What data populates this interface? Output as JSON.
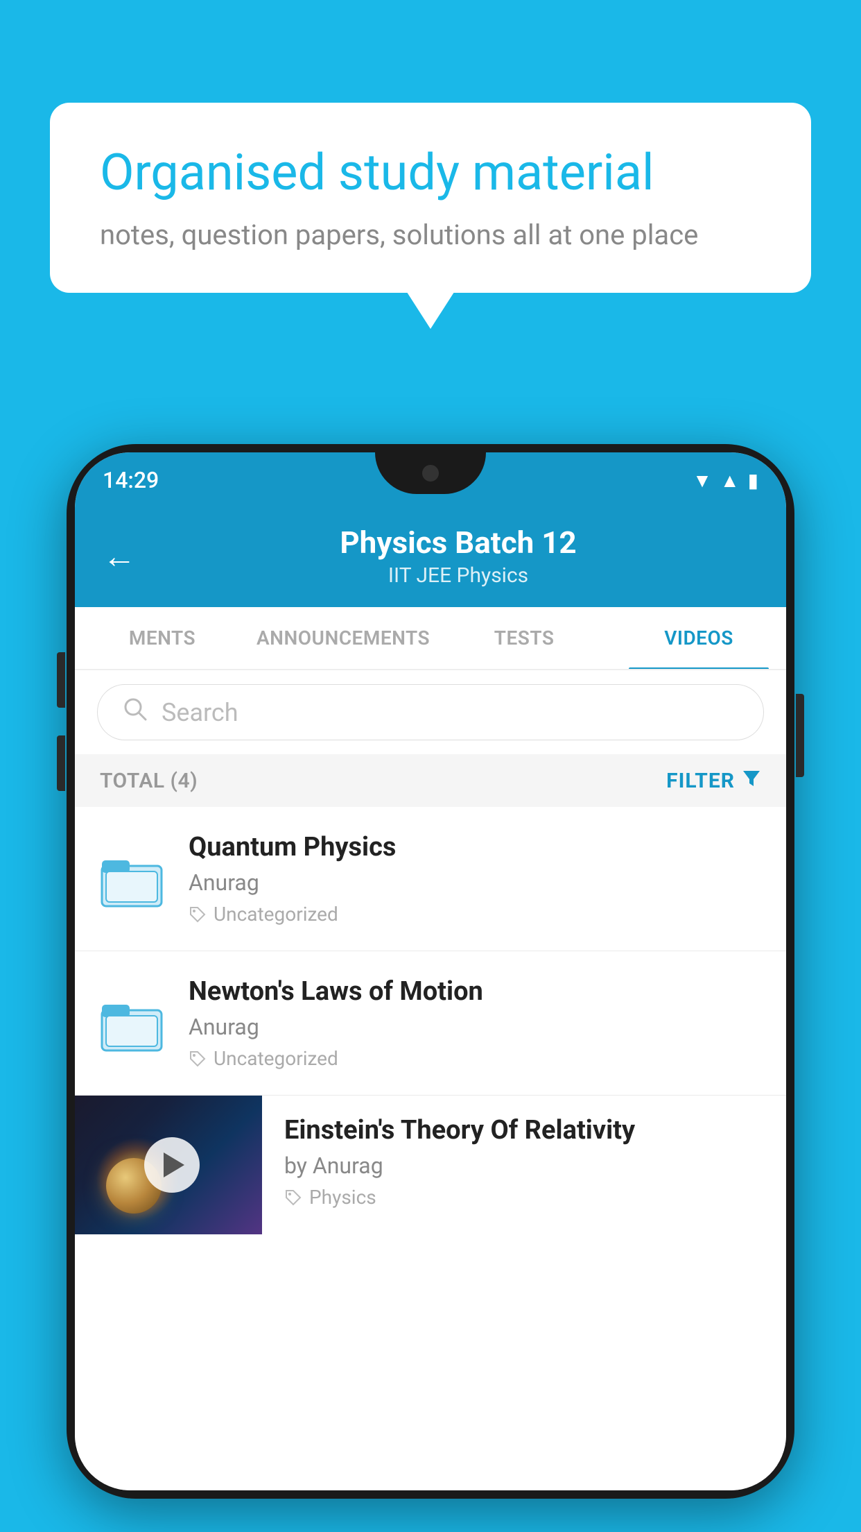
{
  "background_color": "#1ab8e8",
  "bubble": {
    "title": "Organised study material",
    "subtitle": "notes, question papers, solutions all at one place"
  },
  "phone": {
    "status_time": "14:29",
    "header": {
      "back_label": "←",
      "title": "Physics Batch 12",
      "subtitle": "IIT JEE   Physics"
    },
    "tabs": [
      {
        "label": "MENTS",
        "active": false
      },
      {
        "label": "ANNOUNCEMENTS",
        "active": false
      },
      {
        "label": "TESTS",
        "active": false
      },
      {
        "label": "VIDEOS",
        "active": true
      }
    ],
    "search": {
      "placeholder": "Search"
    },
    "filter_bar": {
      "total_label": "TOTAL (4)",
      "filter_label": "FILTER"
    },
    "videos": [
      {
        "title": "Quantum Physics",
        "author": "Anurag",
        "tag": "Uncategorized",
        "has_thumbnail": false
      },
      {
        "title": "Newton's Laws of Motion",
        "author": "Anurag",
        "tag": "Uncategorized",
        "has_thumbnail": false
      },
      {
        "title": "Einstein's Theory Of Relativity",
        "author": "by Anurag",
        "tag": "Physics",
        "has_thumbnail": true
      }
    ]
  }
}
